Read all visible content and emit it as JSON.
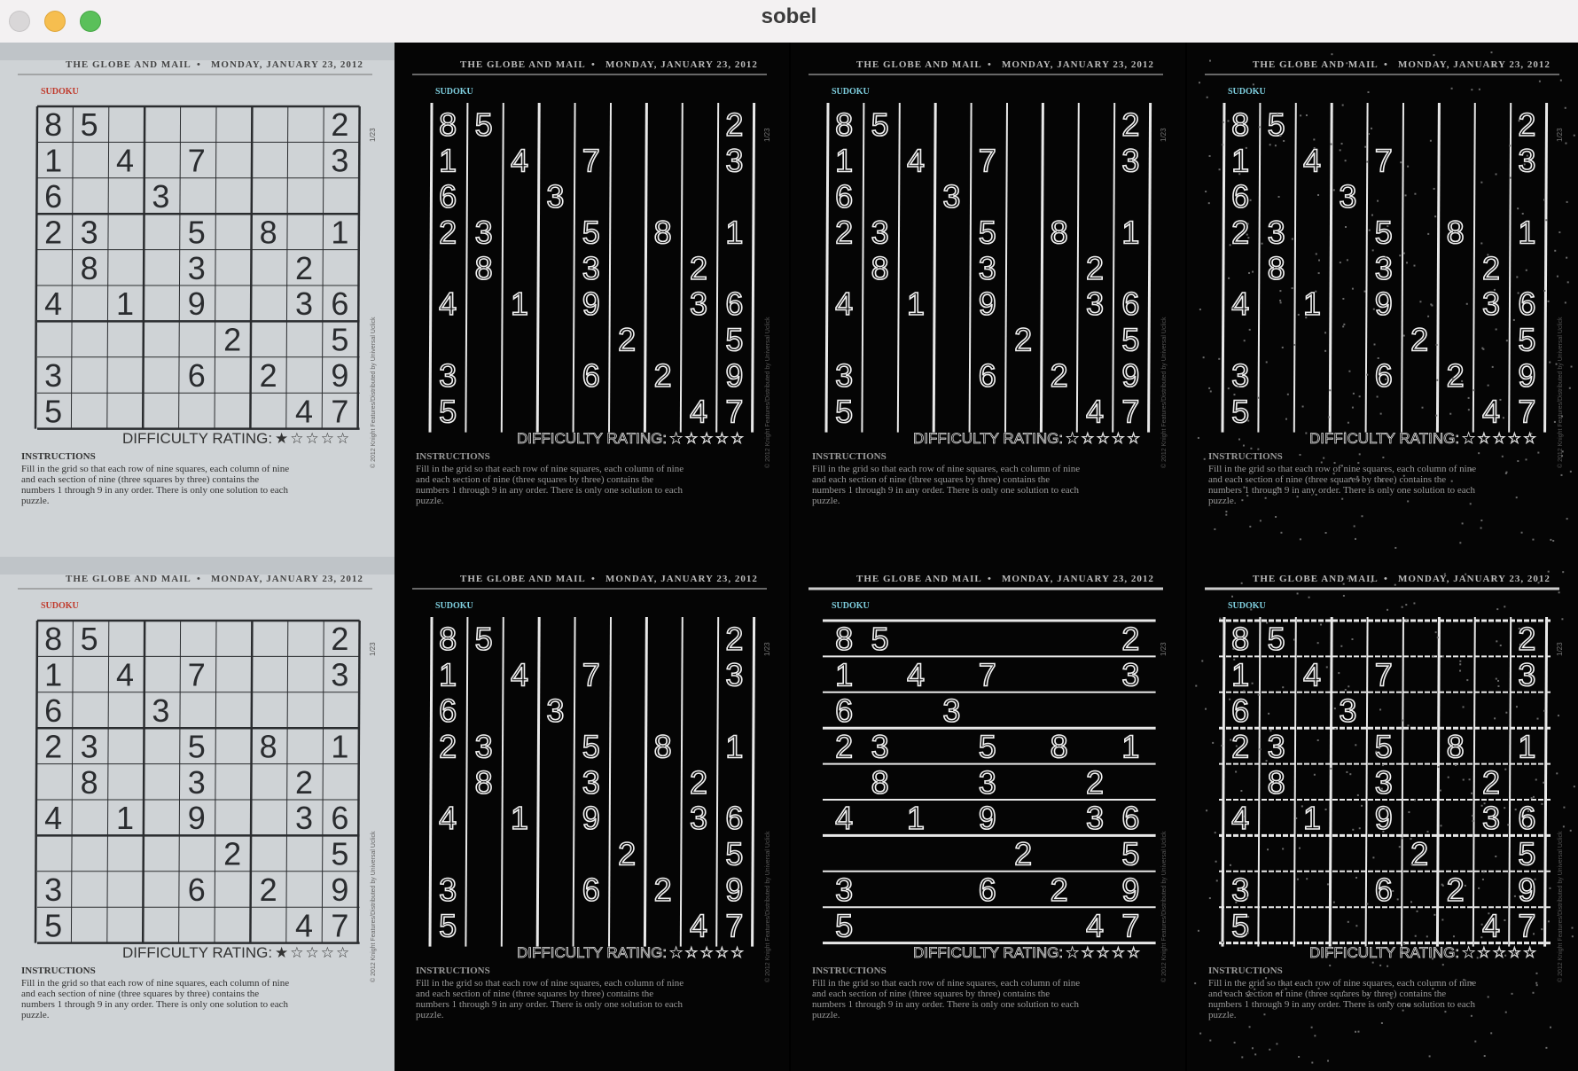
{
  "window": {
    "title": "sobel"
  },
  "paper": {
    "masthead_left": "THE GLOBE AND MAIL",
    "masthead_sep": "•",
    "masthead_right": "MONDAY, JANUARY 23, 2012",
    "section": "SUDOKU",
    "side_text": "© 2012 Knight Features/Distributed by Universal Uclick",
    "puzzle_id": "1/23",
    "difficulty_label": "DIFFICULTY RATING:",
    "difficulty_stars": "★☆☆☆☆",
    "instructions_heading": "INSTRUCTIONS",
    "instructions_lines": [
      "Fill in the grid so that each row of nine squares, each column of nine",
      "and each section of nine (three squares by three) contains the",
      "numbers 1 through 9 in any order. There is only one solution to each",
      "puzzle."
    ]
  },
  "sudoku_rows": [
    [
      "8",
      "5",
      "",
      "",
      "",
      "",
      "",
      "",
      "2"
    ],
    [
      "1",
      "",
      "4",
      "",
      "7",
      "",
      "",
      "",
      "3"
    ],
    [
      "6",
      "",
      "",
      "3",
      "",
      "",
      "",
      "",
      ""
    ],
    [
      "2",
      "3",
      "",
      "",
      "5",
      "",
      "8",
      "",
      "1"
    ],
    [
      "",
      "8",
      "",
      "",
      "3",
      "",
      "",
      "2",
      ""
    ],
    [
      "4",
      "",
      "1",
      "",
      "9",
      "",
      "",
      "3",
      "6"
    ],
    [
      "",
      "",
      "",
      "",
      "",
      "2",
      "",
      "",
      "5"
    ],
    [
      "3",
      "",
      "",
      "",
      "6",
      "",
      "2",
      "",
      "9"
    ],
    [
      "5",
      "",
      "",
      "",
      "",
      "",
      "",
      "4",
      "7"
    ]
  ],
  "panels": [
    {
      "name": "original-image-top",
      "style": "original"
    },
    {
      "name": "sobel-x-panel-1",
      "style": "edge-x"
    },
    {
      "name": "sobel-x-panel-2",
      "style": "edge-x"
    },
    {
      "name": "sobel-x-panel-3",
      "style": "edge-x-noisy"
    },
    {
      "name": "original-image-bottom",
      "style": "original"
    },
    {
      "name": "sobel-x-panel-4",
      "style": "edge-x"
    },
    {
      "name": "sobel-y-panel",
      "style": "edge-y"
    },
    {
      "name": "sobel-magnitude-panel",
      "style": "edge-xy"
    }
  ]
}
